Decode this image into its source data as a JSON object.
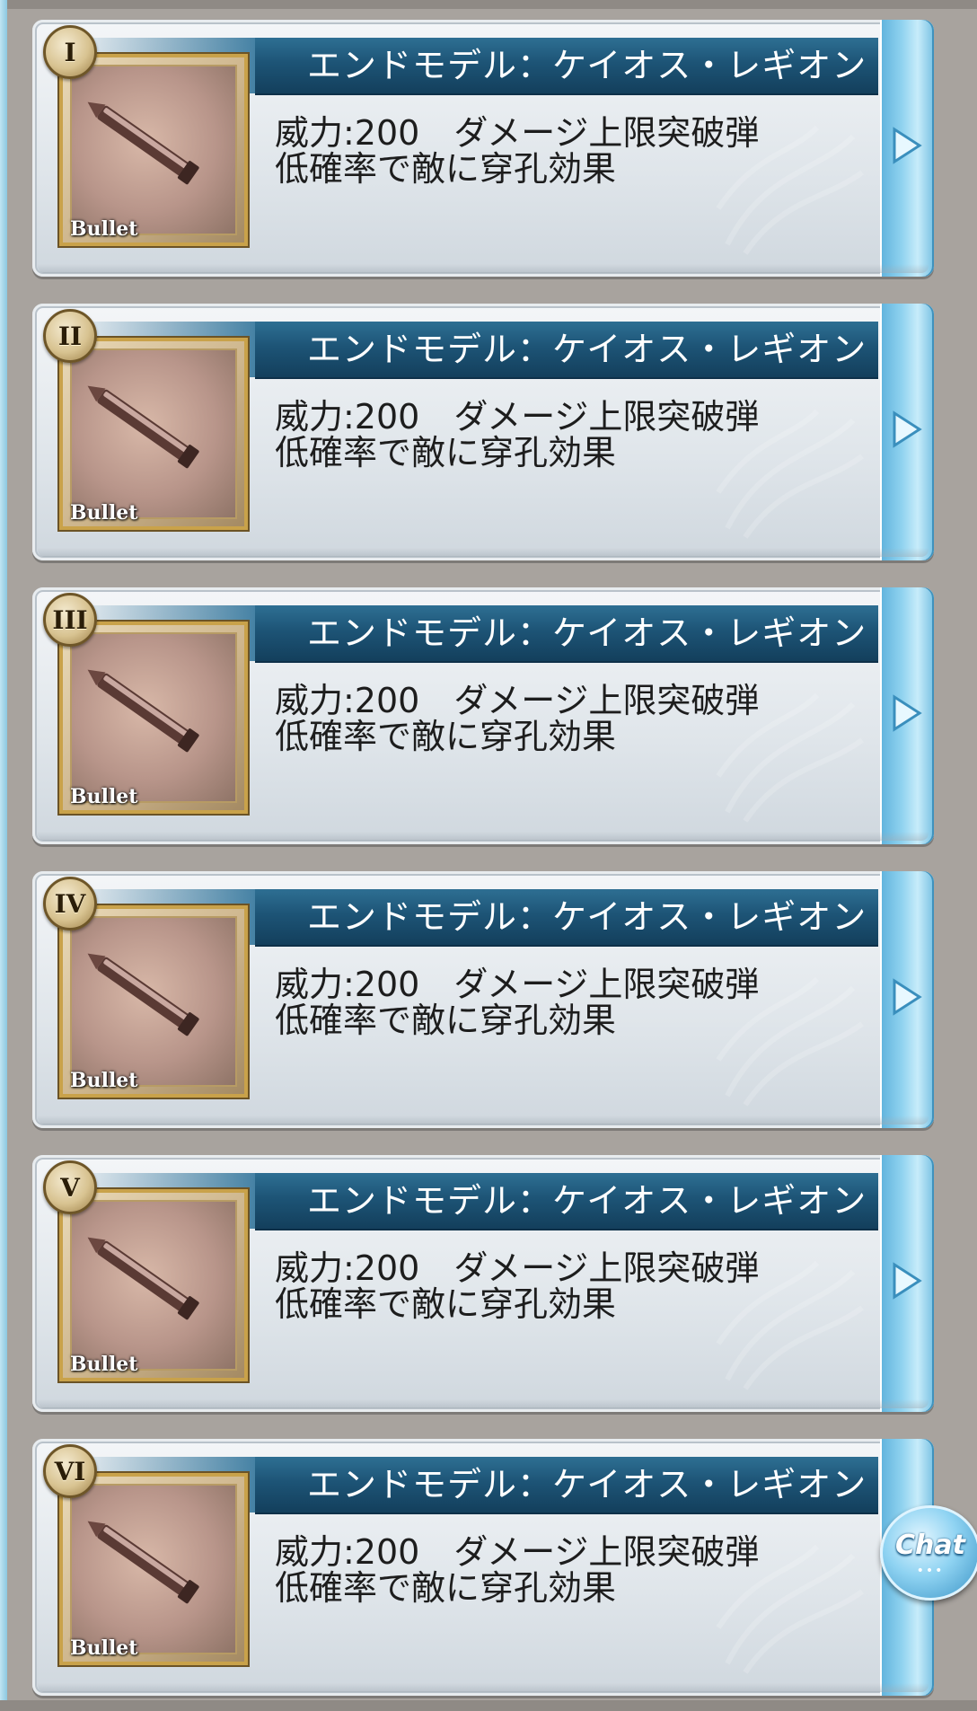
{
  "colors": {
    "title_bar": "#1d5476",
    "card_bg": "#e3e8ec",
    "frame_gold": "#c9a24a",
    "arrow_tab": "#8fd2ef",
    "page_bg": "#a8a39e"
  },
  "items": [
    {
      "numeral": "I",
      "title": "エンドモデル：ケイオス・レギオン",
      "power": "威力:200　ダメージ上限突破弾",
      "effect": "低確率で敵に穿孔効果",
      "type_label": "Bullet",
      "icon": "bullet-icon"
    },
    {
      "numeral": "II",
      "title": "エンドモデル：ケイオス・レギオン",
      "power": "威力:200　ダメージ上限突破弾",
      "effect": "低確率で敵に穿孔効果",
      "type_label": "Bullet",
      "icon": "bullet-icon"
    },
    {
      "numeral": "III",
      "title": "エンドモデル：ケイオス・レギオン",
      "power": "威力:200　ダメージ上限突破弾",
      "effect": "低確率で敵に穿孔効果",
      "type_label": "Bullet",
      "icon": "bullet-icon"
    },
    {
      "numeral": "IV",
      "title": "エンドモデル：ケイオス・レギオン",
      "power": "威力:200　ダメージ上限突破弾",
      "effect": "低確率で敵に穿孔効果",
      "type_label": "Bullet",
      "icon": "bullet-icon"
    },
    {
      "numeral": "V",
      "title": "エンドモデル：ケイオス・レギオン",
      "power": "威力:200　ダメージ上限突破弾",
      "effect": "低確率で敵に穿孔効果",
      "type_label": "Bullet",
      "icon": "bullet-icon"
    },
    {
      "numeral": "VI",
      "title": "エンドモデル：ケイオス・レギオン",
      "power": "威力:200　ダメージ上限突破弾",
      "effect": "低確率で敵に穿孔効果",
      "type_label": "Bullet",
      "icon": "bullet-icon"
    }
  ],
  "chat": {
    "label": "Chat",
    "dots": "•••",
    "icon": "chat-bubble-icon"
  }
}
